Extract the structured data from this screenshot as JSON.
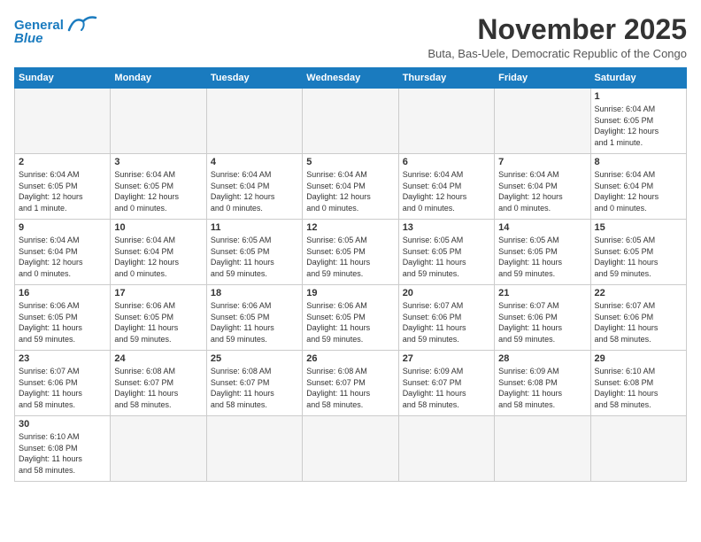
{
  "header": {
    "logo_line1": "General",
    "logo_line2": "Blue",
    "month": "November 2025",
    "subtitle": "Buta, Bas-Uele, Democratic Republic of the Congo"
  },
  "weekdays": [
    "Sunday",
    "Monday",
    "Tuesday",
    "Wednesday",
    "Thursday",
    "Friday",
    "Saturday"
  ],
  "weeks": [
    [
      {
        "day": "",
        "info": ""
      },
      {
        "day": "",
        "info": ""
      },
      {
        "day": "",
        "info": ""
      },
      {
        "day": "",
        "info": ""
      },
      {
        "day": "",
        "info": ""
      },
      {
        "day": "",
        "info": ""
      },
      {
        "day": "1",
        "info": "Sunrise: 6:04 AM\nSunset: 6:05 PM\nDaylight: 12 hours\nand 1 minute."
      }
    ],
    [
      {
        "day": "2",
        "info": "Sunrise: 6:04 AM\nSunset: 6:05 PM\nDaylight: 12 hours\nand 1 minute."
      },
      {
        "day": "3",
        "info": "Sunrise: 6:04 AM\nSunset: 6:05 PM\nDaylight: 12 hours\nand 0 minutes."
      },
      {
        "day": "4",
        "info": "Sunrise: 6:04 AM\nSunset: 6:04 PM\nDaylight: 12 hours\nand 0 minutes."
      },
      {
        "day": "5",
        "info": "Sunrise: 6:04 AM\nSunset: 6:04 PM\nDaylight: 12 hours\nand 0 minutes."
      },
      {
        "day": "6",
        "info": "Sunrise: 6:04 AM\nSunset: 6:04 PM\nDaylight: 12 hours\nand 0 minutes."
      },
      {
        "day": "7",
        "info": "Sunrise: 6:04 AM\nSunset: 6:04 PM\nDaylight: 12 hours\nand 0 minutes."
      },
      {
        "day": "8",
        "info": "Sunrise: 6:04 AM\nSunset: 6:04 PM\nDaylight: 12 hours\nand 0 minutes."
      }
    ],
    [
      {
        "day": "9",
        "info": "Sunrise: 6:04 AM\nSunset: 6:04 PM\nDaylight: 12 hours\nand 0 minutes."
      },
      {
        "day": "10",
        "info": "Sunrise: 6:04 AM\nSunset: 6:04 PM\nDaylight: 12 hours\nand 0 minutes."
      },
      {
        "day": "11",
        "info": "Sunrise: 6:05 AM\nSunset: 6:05 PM\nDaylight: 11 hours\nand 59 minutes."
      },
      {
        "day": "12",
        "info": "Sunrise: 6:05 AM\nSunset: 6:05 PM\nDaylight: 11 hours\nand 59 minutes."
      },
      {
        "day": "13",
        "info": "Sunrise: 6:05 AM\nSunset: 6:05 PM\nDaylight: 11 hours\nand 59 minutes."
      },
      {
        "day": "14",
        "info": "Sunrise: 6:05 AM\nSunset: 6:05 PM\nDaylight: 11 hours\nand 59 minutes."
      },
      {
        "day": "15",
        "info": "Sunrise: 6:05 AM\nSunset: 6:05 PM\nDaylight: 11 hours\nand 59 minutes."
      }
    ],
    [
      {
        "day": "16",
        "info": "Sunrise: 6:06 AM\nSunset: 6:05 PM\nDaylight: 11 hours\nand 59 minutes."
      },
      {
        "day": "17",
        "info": "Sunrise: 6:06 AM\nSunset: 6:05 PM\nDaylight: 11 hours\nand 59 minutes."
      },
      {
        "day": "18",
        "info": "Sunrise: 6:06 AM\nSunset: 6:05 PM\nDaylight: 11 hours\nand 59 minutes."
      },
      {
        "day": "19",
        "info": "Sunrise: 6:06 AM\nSunset: 6:05 PM\nDaylight: 11 hours\nand 59 minutes."
      },
      {
        "day": "20",
        "info": "Sunrise: 6:07 AM\nSunset: 6:06 PM\nDaylight: 11 hours\nand 59 minutes."
      },
      {
        "day": "21",
        "info": "Sunrise: 6:07 AM\nSunset: 6:06 PM\nDaylight: 11 hours\nand 59 minutes."
      },
      {
        "day": "22",
        "info": "Sunrise: 6:07 AM\nSunset: 6:06 PM\nDaylight: 11 hours\nand 58 minutes."
      }
    ],
    [
      {
        "day": "23",
        "info": "Sunrise: 6:07 AM\nSunset: 6:06 PM\nDaylight: 11 hours\nand 58 minutes."
      },
      {
        "day": "24",
        "info": "Sunrise: 6:08 AM\nSunset: 6:07 PM\nDaylight: 11 hours\nand 58 minutes."
      },
      {
        "day": "25",
        "info": "Sunrise: 6:08 AM\nSunset: 6:07 PM\nDaylight: 11 hours\nand 58 minutes."
      },
      {
        "day": "26",
        "info": "Sunrise: 6:08 AM\nSunset: 6:07 PM\nDaylight: 11 hours\nand 58 minutes."
      },
      {
        "day": "27",
        "info": "Sunrise: 6:09 AM\nSunset: 6:07 PM\nDaylight: 11 hours\nand 58 minutes."
      },
      {
        "day": "28",
        "info": "Sunrise: 6:09 AM\nSunset: 6:08 PM\nDaylight: 11 hours\nand 58 minutes."
      },
      {
        "day": "29",
        "info": "Sunrise: 6:10 AM\nSunset: 6:08 PM\nDaylight: 11 hours\nand 58 minutes."
      }
    ],
    [
      {
        "day": "30",
        "info": "Sunrise: 6:10 AM\nSunset: 6:08 PM\nDaylight: 11 hours\nand 58 minutes."
      },
      {
        "day": "",
        "info": ""
      },
      {
        "day": "",
        "info": ""
      },
      {
        "day": "",
        "info": ""
      },
      {
        "day": "",
        "info": ""
      },
      {
        "day": "",
        "info": ""
      },
      {
        "day": "",
        "info": ""
      }
    ]
  ]
}
